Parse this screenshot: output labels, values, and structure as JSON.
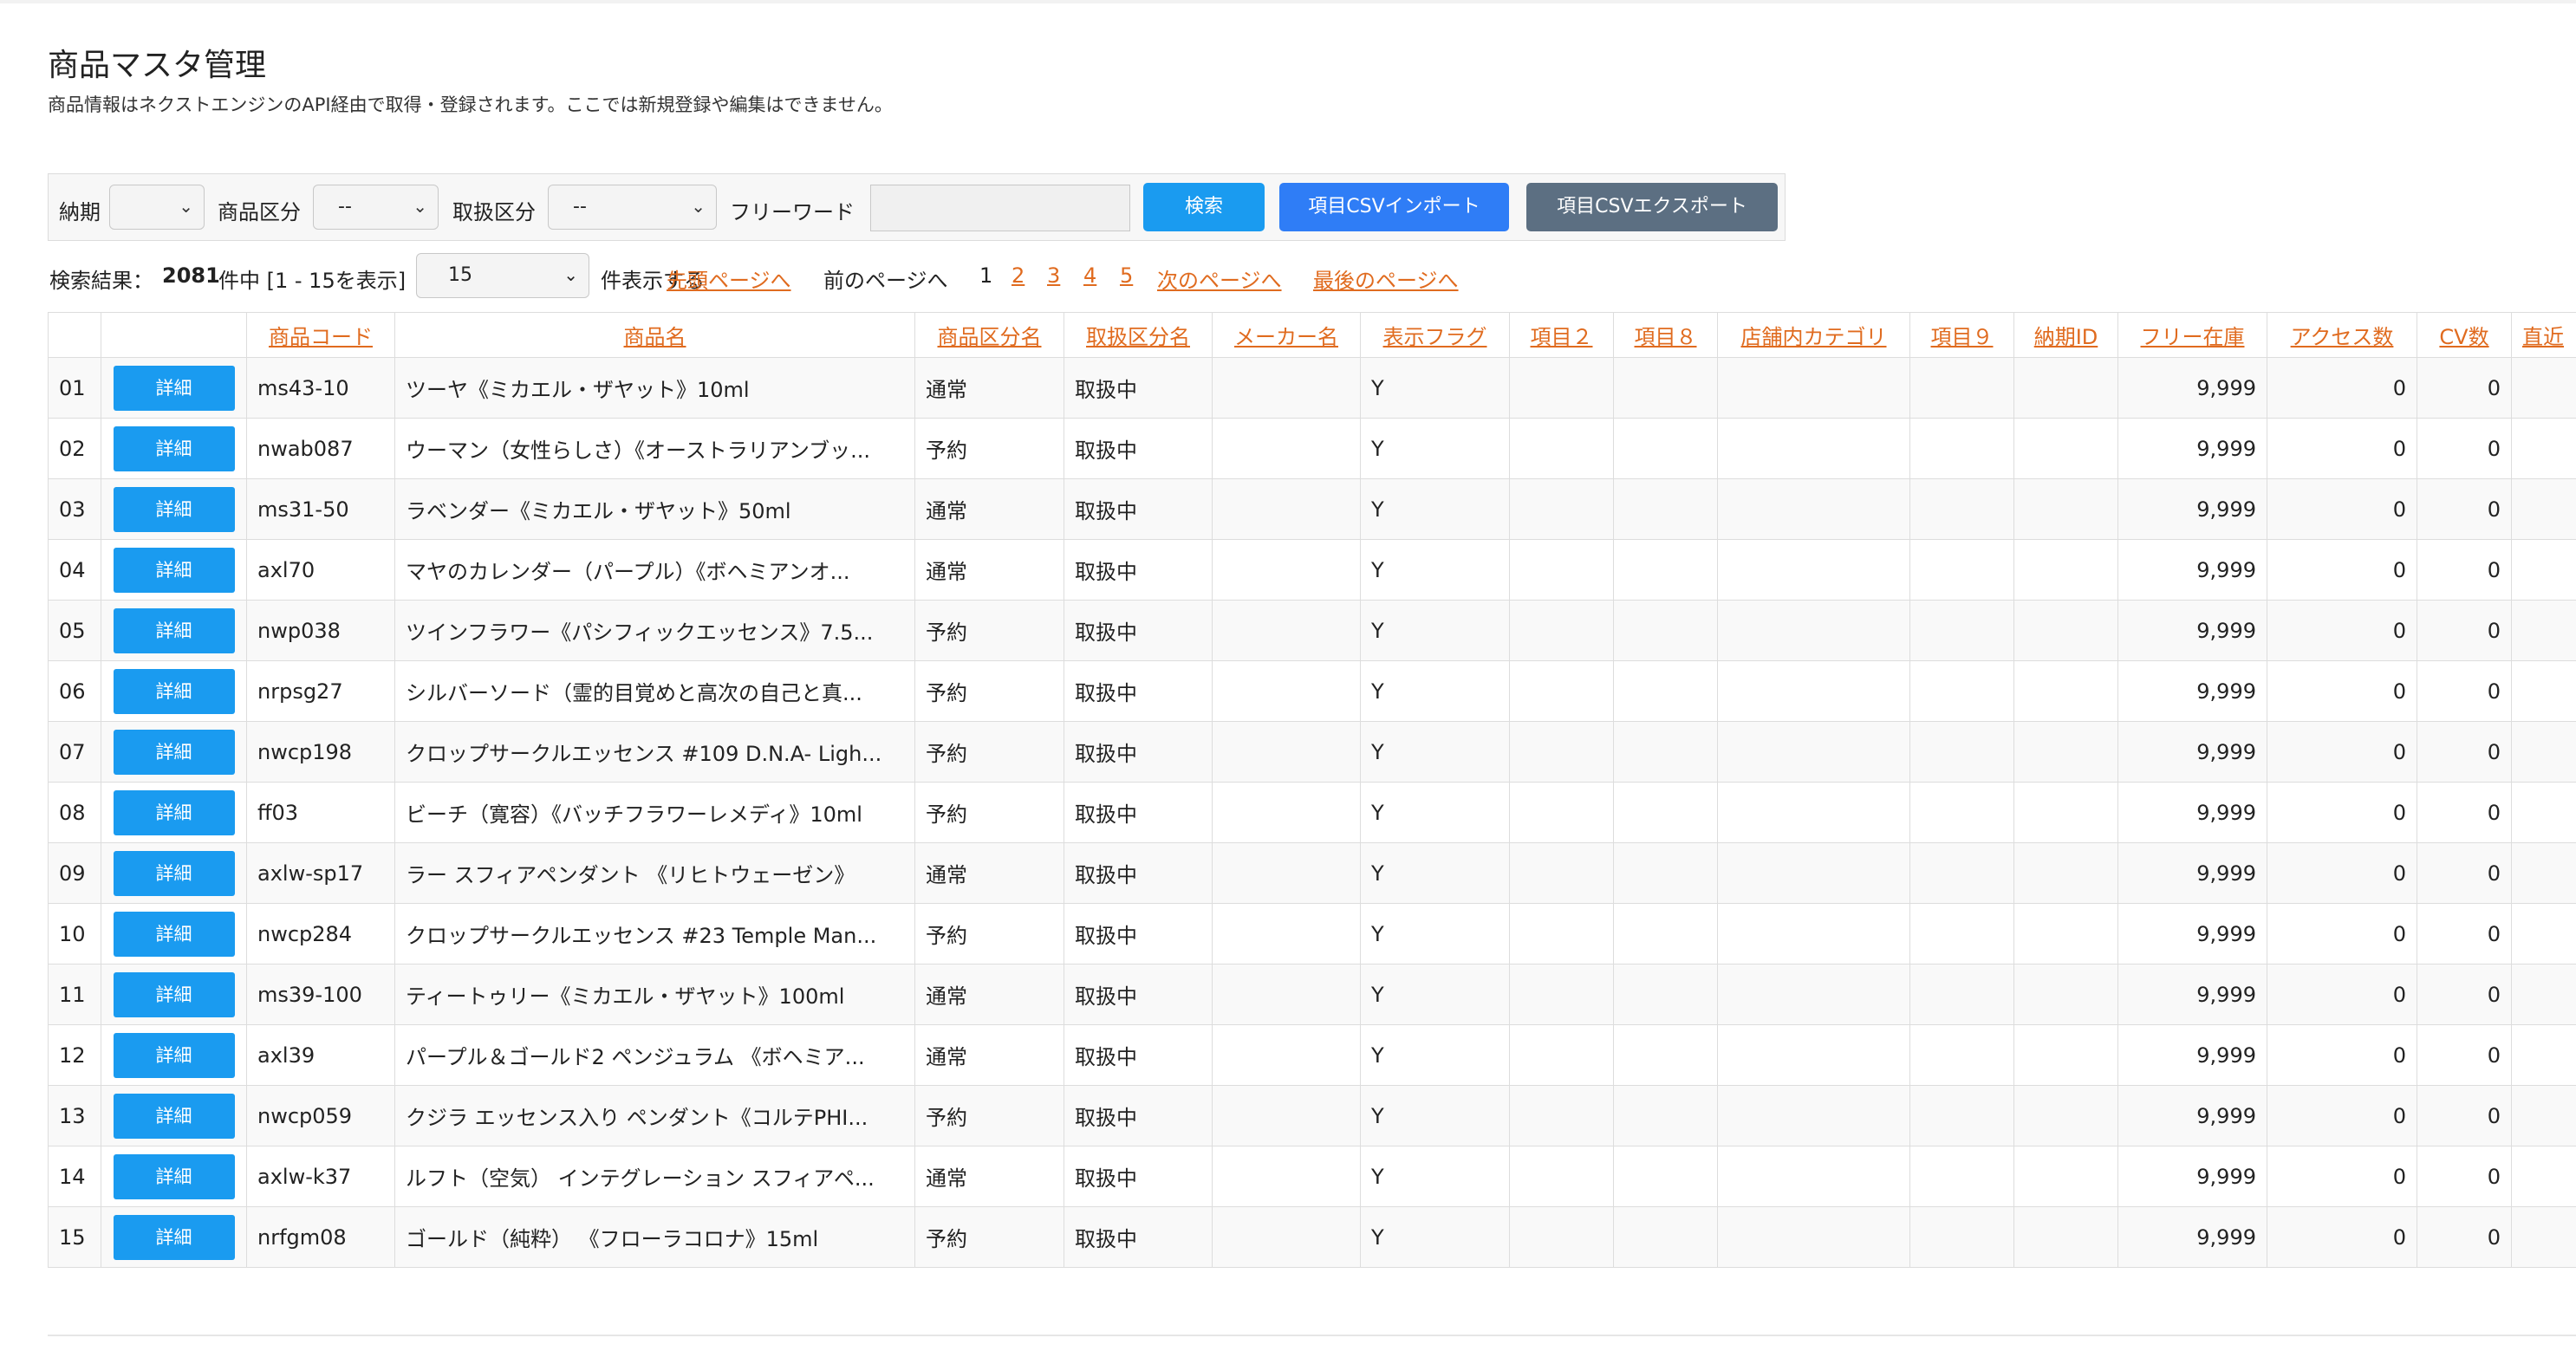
{
  "page": {
    "title": "商品マスタ管理",
    "subtitle": "商品情報はネクストエンジンのAPI経由で取得・登録されます。ここでは新規登録や編集はできません。"
  },
  "search": {
    "delivery_label": "納期",
    "delivery_value": "",
    "category_label": "商品区分",
    "category_value": "--",
    "handling_label": "取扱区分",
    "handling_value": "--",
    "freeword_label": "フリーワード",
    "freeword_value": "",
    "search_button": "検索",
    "import_button": "項目CSVインポート",
    "export_button": "項目CSVエクスポート"
  },
  "result": {
    "prefix": "検索結果：",
    "count": "2081",
    "suffix": "件中 [1 - 15を表示]",
    "per_page": "15",
    "per_page_suffix": "件表示する",
    "first_page": "先頭ページへ",
    "prev_page": "前のページへ",
    "current_page": "1",
    "pages": [
      "2",
      "3",
      "4",
      "5"
    ],
    "next_page": "次のページへ",
    "last_page": "最後のページへ"
  },
  "table": {
    "headers": [
      "商品コード",
      "商品名",
      "商品区分名",
      "取扱区分名",
      "メーカー名",
      "表示フラグ",
      "項目２",
      "項目８",
      "店舗内カテゴリ",
      "項目９",
      "納期ID",
      "フリー在庫",
      "アクセス数",
      "CV数",
      "直近"
    ],
    "detail_label": "詳細",
    "rows": [
      {
        "no": "01",
        "code": "ms43-10",
        "name": "ツーヤ《ミカエル・ザヤット》10ml",
        "category": "通常",
        "handling": "取扱中",
        "maker": "",
        "flag": "Y",
        "stock": "9,999",
        "access": "0",
        "cv": "0"
      },
      {
        "no": "02",
        "code": "nwab087",
        "name": "ウーマン（女性らしさ）《オーストラリアンブッ...",
        "category": "予約",
        "handling": "取扱中",
        "maker": "",
        "flag": "Y",
        "stock": "9,999",
        "access": "0",
        "cv": "0"
      },
      {
        "no": "03",
        "code": "ms31-50",
        "name": "ラベンダー《ミカエル・ザヤット》50ml",
        "category": "通常",
        "handling": "取扱中",
        "maker": "",
        "flag": "Y",
        "stock": "9,999",
        "access": "0",
        "cv": "0"
      },
      {
        "no": "04",
        "code": "axl70",
        "name": "マヤのカレンダー（パープル）《ボヘミアンオ...",
        "category": "通常",
        "handling": "取扱中",
        "maker": "",
        "flag": "Y",
        "stock": "9,999",
        "access": "0",
        "cv": "0"
      },
      {
        "no": "05",
        "code": "nwp038",
        "name": "ツインフラワー《パシフィックエッセンス》7.5...",
        "category": "予約",
        "handling": "取扱中",
        "maker": "",
        "flag": "Y",
        "stock": "9,999",
        "access": "0",
        "cv": "0"
      },
      {
        "no": "06",
        "code": "nrpsg27",
        "name": "シルバーソード（霊的目覚めと高次の自己と真...",
        "category": "予約",
        "handling": "取扱中",
        "maker": "",
        "flag": "Y",
        "stock": "9,999",
        "access": "0",
        "cv": "0"
      },
      {
        "no": "07",
        "code": "nwcp198",
        "name": "クロップサークルエッセンス #109 D.N.A- Ligh...",
        "category": "予約",
        "handling": "取扱中",
        "maker": "",
        "flag": "Y",
        "stock": "9,999",
        "access": "0",
        "cv": "0"
      },
      {
        "no": "08",
        "code": "ff03",
        "name": "ビーチ（寛容）《バッチフラワーレメディ》10ml",
        "category": "予約",
        "handling": "取扱中",
        "maker": "",
        "flag": "Y",
        "stock": "9,999",
        "access": "0",
        "cv": "0"
      },
      {
        "no": "09",
        "code": "axlw-sp17",
        "name": "ラー スフィアペンダント 《リヒトウェーゼン》",
        "category": "通常",
        "handling": "取扱中",
        "maker": "",
        "flag": "Y",
        "stock": "9,999",
        "access": "0",
        "cv": "0"
      },
      {
        "no": "10",
        "code": "nwcp284",
        "name": "クロップサークルエッセンス #23 Temple Man...",
        "category": "予約",
        "handling": "取扱中",
        "maker": "",
        "flag": "Y",
        "stock": "9,999",
        "access": "0",
        "cv": "0"
      },
      {
        "no": "11",
        "code": "ms39-100",
        "name": "ティートゥリー《ミカエル・ザヤット》100ml",
        "category": "通常",
        "handling": "取扱中",
        "maker": "",
        "flag": "Y",
        "stock": "9,999",
        "access": "0",
        "cv": "0"
      },
      {
        "no": "12",
        "code": "axl39",
        "name": "パープル＆ゴールド2 ペンジュラム 《ボヘミア...",
        "category": "通常",
        "handling": "取扱中",
        "maker": "",
        "flag": "Y",
        "stock": "9,999",
        "access": "0",
        "cv": "0"
      },
      {
        "no": "13",
        "code": "nwcp059",
        "name": "クジラ エッセンス入り ペンダント《コルテPHI...",
        "category": "予約",
        "handling": "取扱中",
        "maker": "",
        "flag": "Y",
        "stock": "9,999",
        "access": "0",
        "cv": "0"
      },
      {
        "no": "14",
        "code": "axlw-k37",
        "name": "ルフト（空気） インテグレーション スフィアペ...",
        "category": "通常",
        "handling": "取扱中",
        "maker": "",
        "flag": "Y",
        "stock": "9,999",
        "access": "0",
        "cv": "0"
      },
      {
        "no": "15",
        "code": "nrfgm08",
        "name": "ゴールド（純粋） 《フローラコロナ》15ml",
        "category": "予約",
        "handling": "取扱中",
        "maker": "",
        "flag": "Y",
        "stock": "9,999",
        "access": "0",
        "cv": "0"
      }
    ]
  },
  "colors": {
    "link": "#e06b1f",
    "primary": "#1a9bf0",
    "import": "#2f7df6",
    "export": "#5c6f82"
  }
}
